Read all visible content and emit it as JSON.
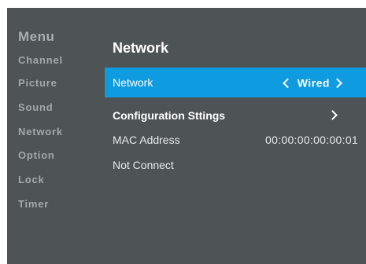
{
  "sidebar": {
    "title": "Menu",
    "items": [
      {
        "label": "Channel"
      },
      {
        "label": "Picture"
      },
      {
        "label": "Sound"
      },
      {
        "label": "Network"
      },
      {
        "label": "Option"
      },
      {
        "label": "Lock"
      },
      {
        "label": "Timer"
      }
    ]
  },
  "main": {
    "title": "Network",
    "rows": [
      {
        "label": "Network",
        "value": "Wired",
        "selected": true,
        "icons": [
          "chevron-left-icon",
          "chevron-right-icon"
        ]
      },
      {
        "label": "Configuration Sttings",
        "icon": "chevron-right-icon"
      },
      {
        "label": "MAC Address",
        "value": "00:00:00:00:00:01"
      },
      {
        "label": "Not Connect"
      }
    ]
  },
  "colors": {
    "screen_background": "#4e5456",
    "selected_row": "#0f9be0",
    "sidebar_text": "#a3a8aa",
    "main_text": "#ffffff"
  }
}
